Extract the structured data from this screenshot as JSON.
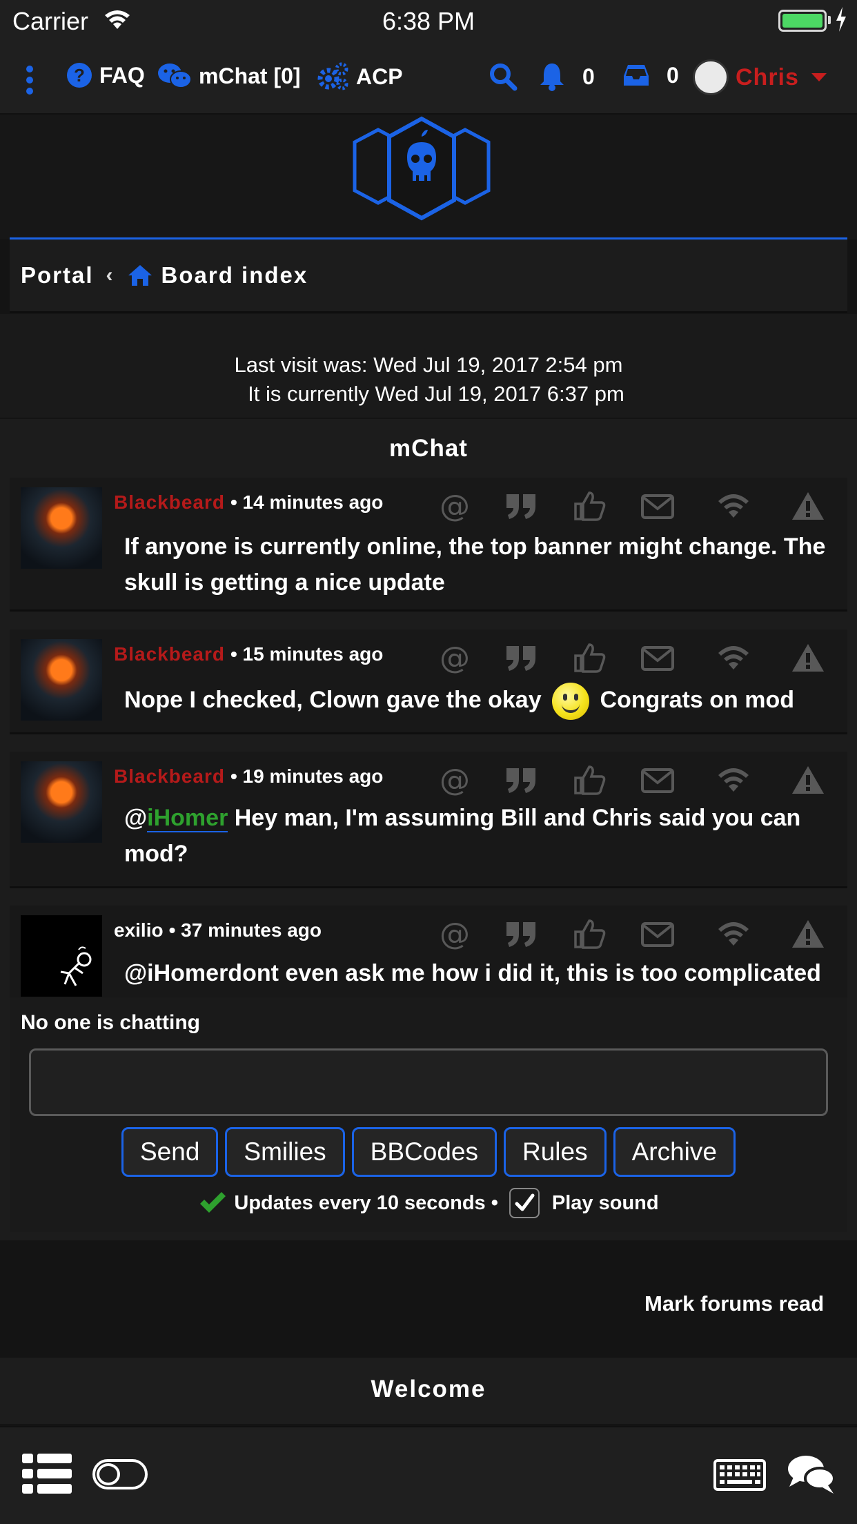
{
  "status_bar": {
    "carrier": "Carrier",
    "time": "6:38 PM"
  },
  "nav": {
    "faq": "FAQ",
    "mchat": "mChat [0]",
    "acp": "ACP",
    "notifications_count": "0",
    "inbox_count": "0",
    "username": "Chris"
  },
  "breadcrumb": {
    "portal": "Portal",
    "separator": "‹",
    "board_index": "Board index"
  },
  "visit": {
    "last_visit": "Last visit was: Wed Jul 19, 2017 2:54 pm",
    "current_time": "It is currently Wed Jul 19, 2017 6:37 pm"
  },
  "mchat": {
    "title": "mChat",
    "messages": [
      {
        "author": "Blackbeard",
        "time": "• 14 minutes ago",
        "text": "If anyone is currently online, the top banner might change. The skull is getting a nice update"
      },
      {
        "author": "Blackbeard",
        "time": "• 15 minutes ago",
        "text_before": "Nope I checked, Clown gave the okay",
        "text_after": "Congrats on mod"
      },
      {
        "author": "Blackbeard",
        "time": "• 19 minutes ago",
        "at": "@",
        "mention": "iHomer",
        "text": " Hey man, I'm assuming Bill and Chris said you can mod?"
      },
      {
        "author": "exilio",
        "time": "• 37 minutes ago",
        "text": "@iHomerdont even ask me how i did it, this is too complicated"
      }
    ],
    "chatting_status": "No one is chatting",
    "input_value": "",
    "buttons": {
      "send": "Send",
      "smilies": "Smilies",
      "bbcodes": "BBCodes",
      "rules": "Rules",
      "archive": "Archive"
    },
    "updates_text": "Updates every 10 seconds •",
    "play_sound": "Play sound",
    "play_sound_checked": true
  },
  "mark_forums_read": "Mark forums read",
  "welcome": "Welcome",
  "colors": {
    "accent": "#1b63e6",
    "username_red": "#c81e1e",
    "mention_green": "#2ea12e",
    "ok_green": "#2ea12e"
  }
}
